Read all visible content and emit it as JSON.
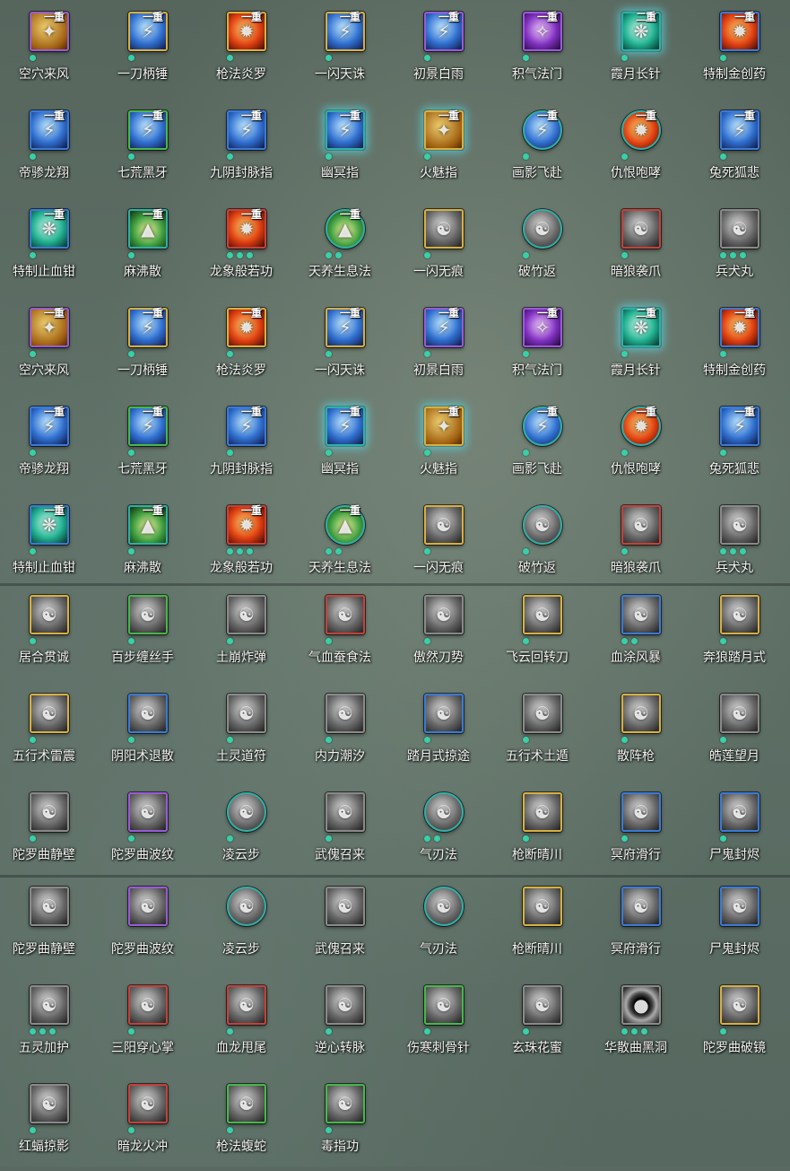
{
  "colors": {
    "gold": "#d8b040",
    "purple": "#9a5ad8",
    "green": "#46b84a",
    "blue": "#3a7ad8",
    "red": "#c8403a",
    "teal": "#2fb0a8",
    "grey": "#8a8a8a",
    "dot": "#38d0a8"
  },
  "sections": [
    {
      "rows": [
        [
          {
            "label": "空穴来风",
            "tier": "一重",
            "frame": "purple",
            "art": "gold",
            "dots": 1
          },
          {
            "label": "一刀柄锤",
            "tier": "一重",
            "frame": "gold",
            "art": "blue",
            "dots": 1
          },
          {
            "label": "枪法炎罗",
            "tier": "一重",
            "frame": "gold",
            "art": "fire",
            "dots": 1
          },
          {
            "label": "一闪天诛",
            "tier": "一重",
            "frame": "gold",
            "art": "blue",
            "dots": 1
          },
          {
            "label": "初景白雨",
            "tier": "一重",
            "frame": "purple",
            "art": "blue",
            "dots": 1
          },
          {
            "label": "积气法门",
            "tier": "一重",
            "frame": "purple",
            "art": "purple",
            "dots": 1
          },
          {
            "label": "霞月长针",
            "tier": "二重",
            "frame": "teal",
            "art": "teal",
            "dots": 1,
            "glow": true
          },
          {
            "label": "特制金创药",
            "tier": "一重",
            "frame": "blue",
            "art": "fire",
            "dots": 1
          }
        ],
        [
          {
            "label": "帝骖龙翔",
            "tier": "一重",
            "frame": "blue",
            "art": "blue",
            "dots": 1
          },
          {
            "label": "七荒黑牙",
            "tier": "一重",
            "frame": "green",
            "art": "blue",
            "dots": 1
          },
          {
            "label": "九阴封脉指",
            "tier": "一重",
            "frame": "blue",
            "art": "blue",
            "dots": 1
          },
          {
            "label": "幽冥指",
            "tier": "一重",
            "frame": "teal",
            "art": "blue",
            "dots": 1,
            "glow": true
          },
          {
            "label": "火魅指",
            "tier": "一重",
            "frame": "gold",
            "art": "gold",
            "dots": 1,
            "glow": true
          },
          {
            "label": "画影飞赴",
            "tier": "一重",
            "frame": "teal",
            "art": "blue",
            "dots": 1,
            "round": true
          },
          {
            "label": "仇恨咆哮",
            "tier": "一重",
            "frame": "teal",
            "art": "fire",
            "dots": 1,
            "round": true
          },
          {
            "label": "兔死狐悲",
            "tier": "一重",
            "frame": "blue",
            "art": "blue",
            "dots": 1
          }
        ],
        [
          {
            "label": "特制止血钳",
            "tier": "一重",
            "frame": "blue",
            "art": "teal",
            "dots": 1
          },
          {
            "label": "麻沸散",
            "tier": "一重",
            "frame": "teal",
            "art": "green",
            "dots": 1
          },
          {
            "label": "龙象般若功",
            "tier": "一重",
            "frame": "red",
            "art": "fire",
            "dots": 3
          },
          {
            "label": "天养生息法",
            "tier": "一重",
            "frame": "teal",
            "art": "green",
            "dots": 2,
            "round": true
          },
          {
            "label": "一闪无痕",
            "tier": "",
            "frame": "gold",
            "art": "grey",
            "dots": 1
          },
          {
            "label": "破竹返",
            "tier": "",
            "frame": "teal",
            "art": "grey",
            "dots": 1,
            "round": true
          },
          {
            "label": "暗狼袭爪",
            "tier": "",
            "frame": "red",
            "art": "grey",
            "dots": 1
          },
          {
            "label": "兵犬丸",
            "tier": "",
            "frame": "grey",
            "art": "grey",
            "dots": 3
          }
        ],
        [
          {
            "label": "空穴来风",
            "tier": "一重",
            "frame": "purple",
            "art": "gold",
            "dots": 1
          },
          {
            "label": "一刀柄锤",
            "tier": "一重",
            "frame": "gold",
            "art": "blue",
            "dots": 1
          },
          {
            "label": "枪法炎罗",
            "tier": "一重",
            "frame": "gold",
            "art": "fire",
            "dots": 1
          },
          {
            "label": "一闪天诛",
            "tier": "一重",
            "frame": "gold",
            "art": "blue",
            "dots": 1
          },
          {
            "label": "初景白雨",
            "tier": "一重",
            "frame": "purple",
            "art": "blue",
            "dots": 1
          },
          {
            "label": "积气法门",
            "tier": "一重",
            "frame": "purple",
            "art": "purple",
            "dots": 1
          },
          {
            "label": "霞月长针",
            "tier": "二重",
            "frame": "teal",
            "art": "teal",
            "dots": 1,
            "glow": true
          },
          {
            "label": "特制金创药",
            "tier": "一重",
            "frame": "blue",
            "art": "fire",
            "dots": 1
          }
        ],
        [
          {
            "label": "帝骖龙翔",
            "tier": "一重",
            "frame": "blue",
            "art": "blue",
            "dots": 1
          },
          {
            "label": "七荒黑牙",
            "tier": "一重",
            "frame": "green",
            "art": "blue",
            "dots": 1
          },
          {
            "label": "九阴封脉指",
            "tier": "一重",
            "frame": "blue",
            "art": "blue",
            "dots": 1
          },
          {
            "label": "幽冥指",
            "tier": "一重",
            "frame": "teal",
            "art": "blue",
            "dots": 1,
            "glow": true
          },
          {
            "label": "火魅指",
            "tier": "一重",
            "frame": "gold",
            "art": "gold",
            "dots": 1,
            "glow": true
          },
          {
            "label": "画影飞赴",
            "tier": "一重",
            "frame": "teal",
            "art": "blue",
            "dots": 1,
            "round": true
          },
          {
            "label": "仇恨咆哮",
            "tier": "一重",
            "frame": "teal",
            "art": "fire",
            "dots": 1,
            "round": true
          },
          {
            "label": "兔死狐悲",
            "tier": "一重",
            "frame": "blue",
            "art": "blue",
            "dots": 1
          }
        ],
        [
          {
            "label": "特制止血钳",
            "tier": "一重",
            "frame": "blue",
            "art": "teal",
            "dots": 1
          },
          {
            "label": "麻沸散",
            "tier": "一重",
            "frame": "teal",
            "art": "green",
            "dots": 1
          },
          {
            "label": "龙象般若功",
            "tier": "一重",
            "frame": "red",
            "art": "fire",
            "dots": 3
          },
          {
            "label": "天养生息法",
            "tier": "一重",
            "frame": "teal",
            "art": "green",
            "dots": 2,
            "round": true
          },
          {
            "label": "一闪无痕",
            "tier": "",
            "frame": "gold",
            "art": "grey",
            "dots": 1
          },
          {
            "label": "破竹返",
            "tier": "",
            "frame": "teal",
            "art": "grey",
            "dots": 1,
            "round": true
          },
          {
            "label": "暗狼袭爪",
            "tier": "",
            "frame": "red",
            "art": "grey",
            "dots": 1
          },
          {
            "label": "兵犬丸",
            "tier": "",
            "frame": "grey",
            "art": "grey",
            "dots": 3
          }
        ]
      ]
    },
    {
      "rows": [
        [
          {
            "label": "居合贯诚",
            "tier": "",
            "frame": "gold",
            "art": "grey",
            "dots": 1
          },
          {
            "label": "百步缠丝手",
            "tier": "",
            "frame": "green",
            "art": "grey",
            "dots": 1
          },
          {
            "label": "土崩炸弹",
            "tier": "",
            "frame": "grey",
            "art": "grey",
            "dots": 1
          },
          {
            "label": "气血蚕食法",
            "tier": "",
            "frame": "red",
            "art": "grey",
            "dots": 1
          },
          {
            "label": "傲然刀势",
            "tier": "",
            "frame": "grey",
            "art": "grey",
            "dots": 1
          },
          {
            "label": "飞云回转刀",
            "tier": "",
            "frame": "gold",
            "art": "grey",
            "dots": 1
          },
          {
            "label": "血涂风暴",
            "tier": "",
            "frame": "blue",
            "art": "grey",
            "dots": 2
          },
          {
            "label": "奔狼踏月式",
            "tier": "",
            "frame": "gold",
            "art": "grey",
            "dots": 1
          }
        ],
        [
          {
            "label": "五行术雷震",
            "tier": "",
            "frame": "gold",
            "art": "grey",
            "dots": 1
          },
          {
            "label": "阴阳术退散",
            "tier": "",
            "frame": "blue",
            "art": "grey",
            "dots": 1
          },
          {
            "label": "土灵道符",
            "tier": "",
            "frame": "grey",
            "art": "grey",
            "dots": 1
          },
          {
            "label": "内力潮汐",
            "tier": "",
            "frame": "grey",
            "art": "grey",
            "dots": 1
          },
          {
            "label": "踏月式掠途",
            "tier": "",
            "frame": "blue",
            "art": "grey",
            "dots": 1
          },
          {
            "label": "五行术土遁",
            "tier": "",
            "frame": "grey",
            "art": "grey",
            "dots": 1
          },
          {
            "label": "散阵枪",
            "tier": "",
            "frame": "gold",
            "art": "grey",
            "dots": 1
          },
          {
            "label": "皓莲望月",
            "tier": "",
            "frame": "grey",
            "art": "grey",
            "dots": 1
          }
        ],
        [
          {
            "label": "陀罗曲静壁",
            "tier": "",
            "frame": "grey",
            "art": "grey",
            "dots": 1
          },
          {
            "label": "陀罗曲波纹",
            "tier": "",
            "frame": "purple",
            "art": "grey",
            "dots": 1
          },
          {
            "label": "凌云步",
            "tier": "",
            "frame": "teal",
            "art": "grey",
            "dots": 1,
            "round": true
          },
          {
            "label": "武傀召来",
            "tier": "",
            "frame": "grey",
            "art": "grey",
            "dots": 1
          },
          {
            "label": "气刃法",
            "tier": "",
            "frame": "teal",
            "art": "grey",
            "dots": 2,
            "round": true
          },
          {
            "label": "枪断晴川",
            "tier": "",
            "frame": "gold",
            "art": "grey",
            "dots": 1
          },
          {
            "label": "冥府滑行",
            "tier": "",
            "frame": "blue",
            "art": "grey",
            "dots": 1
          },
          {
            "label": "尸鬼封烬",
            "tier": "",
            "frame": "blue",
            "art": "grey",
            "dots": 1
          }
        ]
      ]
    },
    {
      "rows": [
        [
          {
            "label": "陀罗曲静壁",
            "tier": "",
            "frame": "grey",
            "art": "grey",
            "dots": 0
          },
          {
            "label": "陀罗曲波纹",
            "tier": "",
            "frame": "purple",
            "art": "grey",
            "dots": 0
          },
          {
            "label": "凌云步",
            "tier": "",
            "frame": "teal",
            "art": "grey",
            "dots": 0,
            "round": true
          },
          {
            "label": "武傀召来",
            "tier": "",
            "frame": "grey",
            "art": "grey",
            "dots": 0
          },
          {
            "label": "气刃法",
            "tier": "",
            "frame": "teal",
            "art": "grey",
            "dots": 0,
            "round": true
          },
          {
            "label": "枪断晴川",
            "tier": "",
            "frame": "gold",
            "art": "grey",
            "dots": 0
          },
          {
            "label": "冥府滑行",
            "tier": "",
            "frame": "blue",
            "art": "grey",
            "dots": 0
          },
          {
            "label": "尸鬼封烬",
            "tier": "",
            "frame": "blue",
            "art": "grey",
            "dots": 0
          }
        ],
        [
          {
            "label": "五灵加护",
            "tier": "",
            "frame": "grey",
            "art": "grey",
            "dots": 3
          },
          {
            "label": "三阳穿心掌",
            "tier": "",
            "frame": "red",
            "art": "grey",
            "dots": 1
          },
          {
            "label": "血龙甩尾",
            "tier": "",
            "frame": "red",
            "art": "grey",
            "dots": 1
          },
          {
            "label": "逆心转脉",
            "tier": "",
            "frame": "grey",
            "art": "grey",
            "dots": 1
          },
          {
            "label": "伤寒刺骨针",
            "tier": "",
            "frame": "green",
            "art": "grey",
            "dots": 1
          },
          {
            "label": "玄珠花蜜",
            "tier": "",
            "frame": "grey",
            "art": "grey",
            "dots": 1
          },
          {
            "label": "华散曲黑洞",
            "tier": "",
            "frame": "grey",
            "art": "dark",
            "dots": 3
          },
          {
            "label": "陀罗曲破镜",
            "tier": "",
            "frame": "gold",
            "art": "grey",
            "dots": 1
          }
        ],
        [
          {
            "label": "红蝠掠影",
            "tier": "",
            "frame": "grey",
            "art": "grey",
            "dots": 1
          },
          {
            "label": "暗龙火冲",
            "tier": "",
            "frame": "red",
            "art": "grey",
            "dots": 1
          },
          {
            "label": "枪法蝮蛇",
            "tier": "",
            "frame": "green",
            "art": "grey",
            "dots": 1
          },
          {
            "label": "毒指功",
            "tier": "",
            "frame": "green",
            "art": "grey",
            "dots": 1
          }
        ]
      ]
    }
  ]
}
